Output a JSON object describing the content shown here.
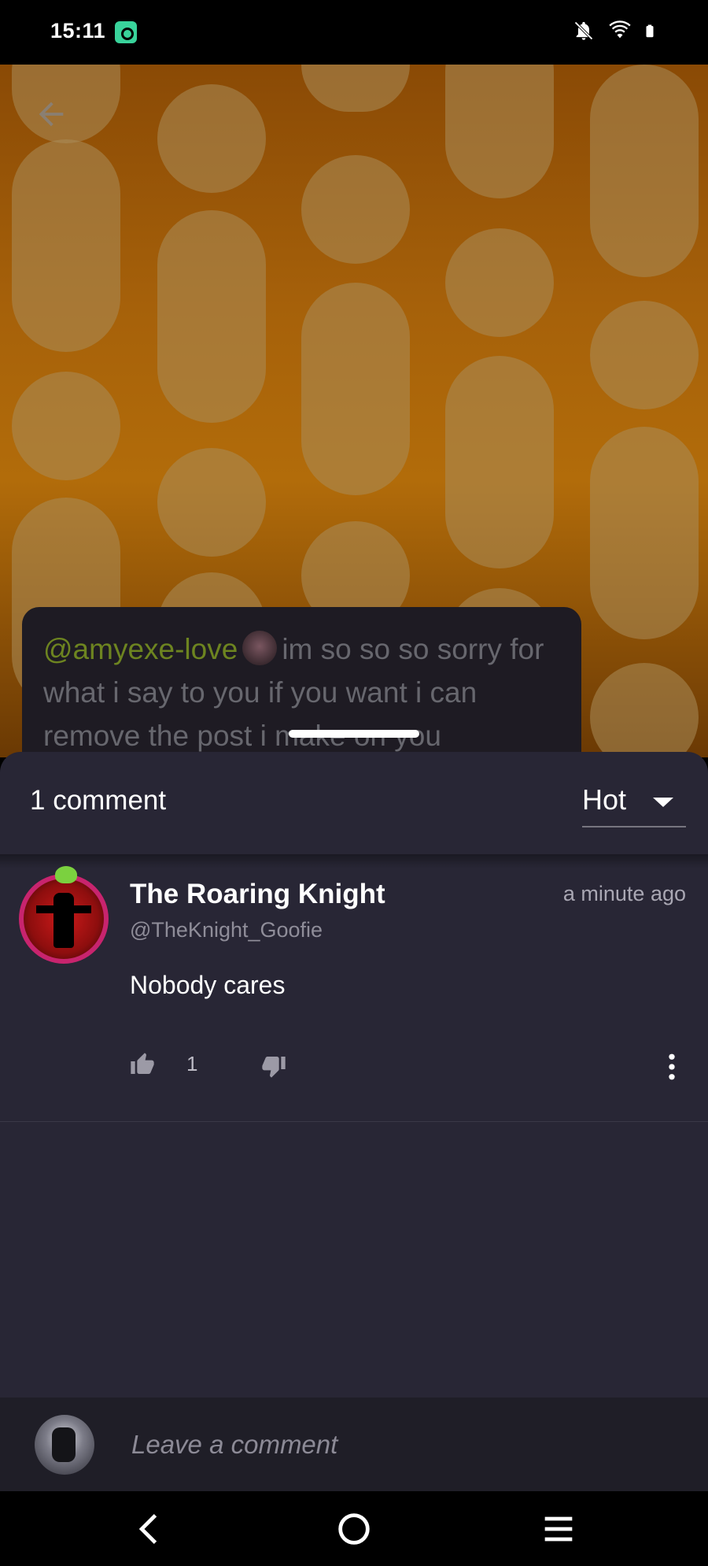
{
  "status_bar": {
    "time": "15:11",
    "icons": [
      "app-notification-icon",
      "bell-off-icon",
      "wifi-icon",
      "battery-icon"
    ]
  },
  "post": {
    "mention": "@amyexe-love",
    "text": "im so so so sorry for what i say to you if you want i can remove the post i make on you"
  },
  "comments_header": {
    "count_label": "1 comment",
    "sort_value": "Hot"
  },
  "comments": [
    {
      "username": "The Roaring Knight",
      "handle": "@TheKnight_Goofie",
      "timestamp": "a minute ago",
      "body": "Nobody cares",
      "likes": "1"
    }
  ],
  "composer": {
    "placeholder": "Leave a comment"
  },
  "colors": {
    "sheet_bg": "#282635",
    "mention": "#6d8420",
    "background_orange": "#a6610a"
  }
}
